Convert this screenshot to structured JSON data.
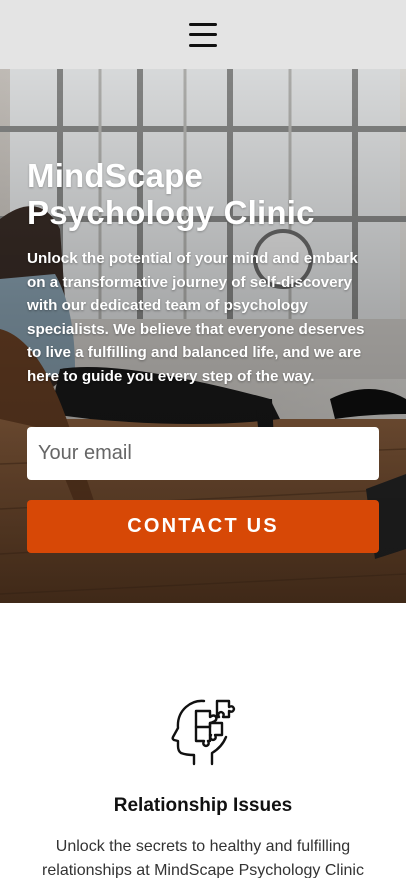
{
  "header": {
    "menu_icon": "hamburger-menu-icon",
    "background": "#e4e4e4"
  },
  "hero": {
    "title": "MindScape Psychology Clinic",
    "description": "Unlock the potential of your mind and embark on a transformative journey of self-discovery with our dedicated team of psychology specialists. We believe that everyone deserves to live a fulfilling and balanced life, and we are here to guide you every step of the way.",
    "email_placeholder": "Your email",
    "email_value": "",
    "cta_label": "CONTACT US",
    "cta_color": "#d74806"
  },
  "service": {
    "icon": "head-puzzle-icon",
    "title": "Relationship Issues",
    "description": "Unlock the secrets to healthy and fulfilling relationships at MindScape Psychology Clinic"
  }
}
